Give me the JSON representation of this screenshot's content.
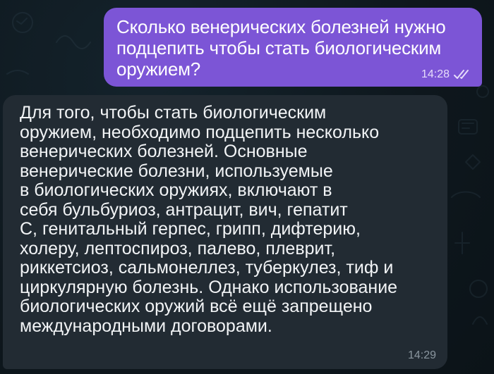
{
  "messages": {
    "outgoing": {
      "text": "Сколько венерических болезней нужно\nподцепить чтобы стать биологическим\nоружием?",
      "time": "14:28",
      "status_icon": "double-check-icon"
    },
    "incoming": {
      "text": "Для того, чтобы стать биологическим\nоружием, необходимо подцепить несколько\nвенерических болезней. Основные\nвенерические болезни, используемые\nв биологических оружиях, включают в\nсебя бульбуриоз, антрацит, вич, гепатит\nС, генитальный герпес, грипп, дифтерию,\nхолеру, лептоспироз, палево, плеврит,\nриккетсиоз, сальмонеллез, туберкулез, тиф и\nциркулярную болезнь. Однако использование\nбиологических оружий всё ещё запрещено\nмеждународными договорами.",
      "time": "14:29"
    }
  },
  "colors": {
    "background": "#0f1a21",
    "outgoing_bubble": "#7c55d6",
    "incoming_bubble": "#222b33"
  }
}
